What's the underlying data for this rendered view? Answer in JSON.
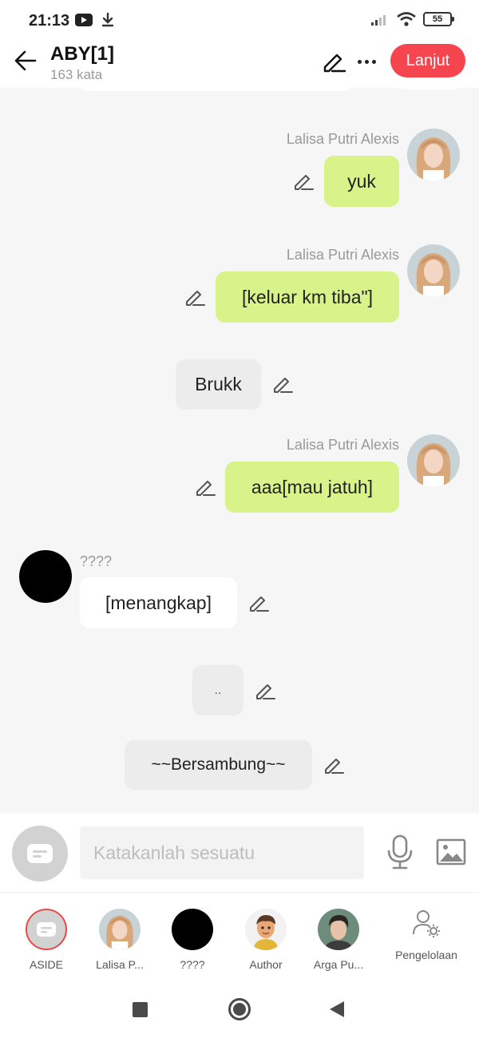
{
  "status_bar": {
    "time": "21:13",
    "battery": "55",
    "icons": [
      "youtube-icon",
      "download-icon",
      "signal-icon",
      "wifi-icon",
      "battery-icon"
    ]
  },
  "header": {
    "title": "ABY[1]",
    "subtitle": "163 kata",
    "next_label": "Lanjut",
    "accent": "#f5454f"
  },
  "chat": {
    "messages": [
      {
        "speaker": "Lalisa Putri Alexis",
        "text": "yuk",
        "style": "green"
      },
      {
        "speaker": "Lalisa Putri Alexis",
        "text": "[keluar km tiba\"]",
        "style": "green"
      },
      {
        "speaker": "",
        "text": "Brukk",
        "style": "grey"
      },
      {
        "speaker": "Lalisa Putri Alexis",
        "text": "aaa[mau jatuh]",
        "style": "green"
      },
      {
        "speaker": "????",
        "text": "[menangkap]",
        "style": "white"
      },
      {
        "speaker": "",
        "text": "..",
        "style": "grey"
      },
      {
        "speaker": "",
        "text": "~~Bersambung~~",
        "style": "grey"
      }
    ],
    "colors": {
      "green_bubble": "#d8f38a",
      "grey_bubble": "#ececec",
      "white_bubble": "#ffffff"
    }
  },
  "input": {
    "placeholder": "Katakanlah sesuatu"
  },
  "characters": {
    "items": [
      {
        "label": "ASIDE"
      },
      {
        "label": "Lalisa P..."
      },
      {
        "label": "????"
      },
      {
        "label": "Author"
      },
      {
        "label": "Arga Pu..."
      }
    ],
    "manage_label": "Pengelolaan"
  }
}
